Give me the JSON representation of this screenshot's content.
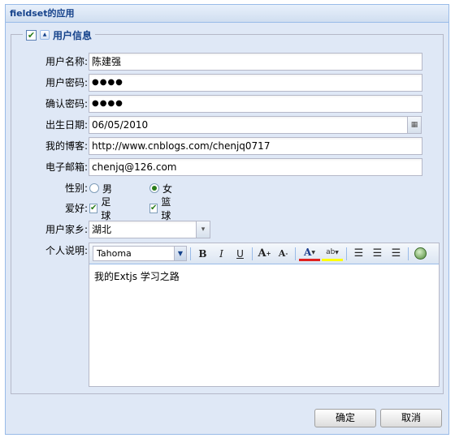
{
  "panel": {
    "title": "fieldset的应用"
  },
  "fieldset": {
    "legend": "用户信息",
    "legend_checked": true
  },
  "form": {
    "username": {
      "label": "用户名称:",
      "value": "陈建强"
    },
    "password": {
      "label": "用户密码:",
      "value": "●●●●"
    },
    "confirm": {
      "label": "确认密码:",
      "value": "●●●●"
    },
    "birthday": {
      "label": "出生日期:",
      "value": "06/05/2010"
    },
    "blog": {
      "label": "我的博客:",
      "value": "http://www.cnblogs.com/chenjq0717"
    },
    "email": {
      "label": "电子邮箱:",
      "value": "chenjq@126.com"
    },
    "gender": {
      "label": "性别:",
      "options": [
        "男",
        "女"
      ],
      "selected": "女"
    },
    "hobby": {
      "label": "爱好:",
      "options": [
        "足球",
        "篮球"
      ],
      "checked": [
        "足球",
        "篮球"
      ]
    },
    "hometown": {
      "label": "用户家乡:",
      "value": "湖北"
    },
    "description": {
      "label": "个人说明:",
      "value": "我的Extjs 学习之路"
    }
  },
  "editor": {
    "font": "Tahoma",
    "tools": [
      "bold-icon",
      "italic-icon",
      "underline-icon",
      "font-grow-icon",
      "font-shrink-icon",
      "font-color-icon",
      "highlight-icon",
      "align-left-icon",
      "align-center-icon",
      "align-right-icon",
      "source-edit-icon"
    ]
  },
  "buttons": {
    "ok": "确定",
    "cancel": "取消"
  }
}
